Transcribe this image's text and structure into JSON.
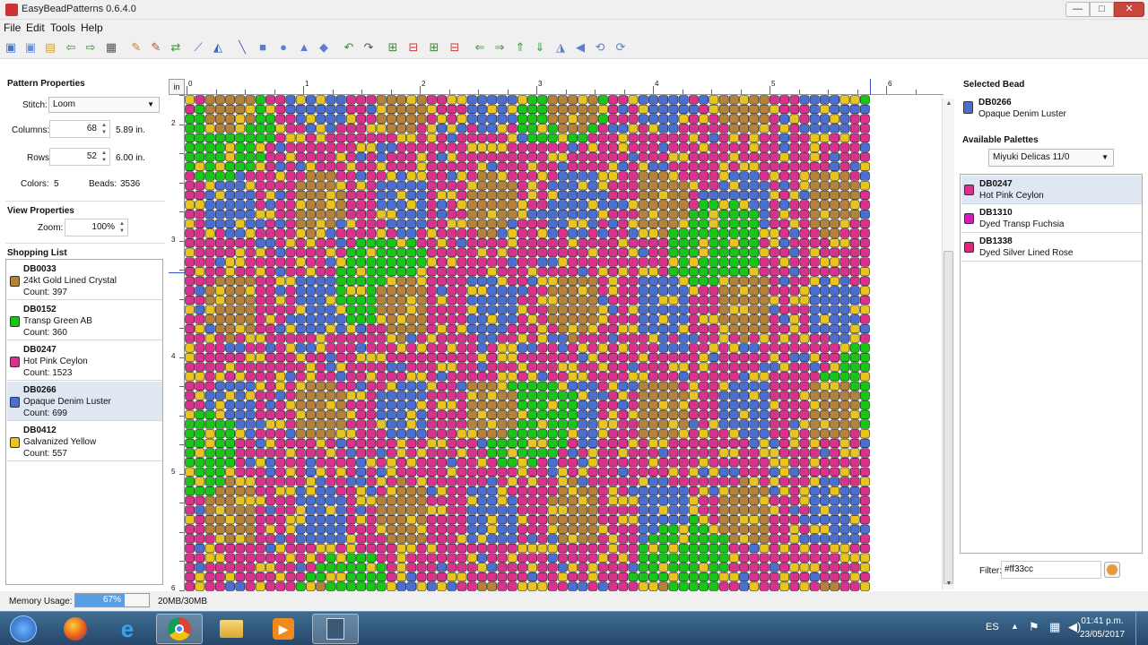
{
  "window": {
    "title": "EasyBeadPatterns 0.6.4.0",
    "min_label": "—",
    "max_label": "□",
    "close_label": "✕"
  },
  "menu": [
    "File",
    "Edit",
    "Tools",
    "Help"
  ],
  "toolbar": [
    {
      "name": "new-icon",
      "glyph": "▣",
      "color": "#4a78c8"
    },
    {
      "name": "new-image-icon",
      "glyph": "▣",
      "color": "#6a8ed8"
    },
    {
      "name": "open-icon",
      "glyph": "▤",
      "color": "#d4a63a"
    },
    {
      "name": "import-icon",
      "glyph": "⇦",
      "color": "#3a8a3a"
    },
    {
      "name": "export-icon",
      "glyph": "⇨",
      "color": "#3a8a3a"
    },
    {
      "name": "print-icon",
      "glyph": "▦",
      "color": "#555555"
    },
    {
      "name": "pencil-icon",
      "glyph": "✎",
      "color": "#d08020"
    },
    {
      "name": "pencil-alt-icon",
      "glyph": "✎",
      "color": "#c05020"
    },
    {
      "name": "replace-color-icon",
      "glyph": "⇄",
      "color": "#3a9a3a"
    },
    {
      "name": "eyedropper-icon",
      "glyph": "⟋",
      "color": "#4466bb"
    },
    {
      "name": "fill-icon",
      "glyph": "◭",
      "color": "#4466bb"
    },
    {
      "name": "line-icon",
      "glyph": "╲",
      "color": "#4466bb"
    },
    {
      "name": "rectangle-icon",
      "glyph": "■",
      "color": "#5a7ed0"
    },
    {
      "name": "circle-icon",
      "glyph": "●",
      "color": "#5a7ed0"
    },
    {
      "name": "triangle-icon",
      "glyph": "▲",
      "color": "#5a7ed0"
    },
    {
      "name": "diamond-icon",
      "glyph": "◆",
      "color": "#5a7ed0"
    },
    {
      "name": "undo-icon",
      "glyph": "↶",
      "color": "#3a8a3a"
    },
    {
      "name": "redo-icon",
      "glyph": "↷",
      "color": "#555555"
    },
    {
      "name": "insert-column-icon",
      "glyph": "⊞",
      "color": "#3a8a3a"
    },
    {
      "name": "delete-column-icon",
      "glyph": "⊟",
      "color": "#c04040"
    },
    {
      "name": "insert-row-icon",
      "glyph": "⊞",
      "color": "#3a8a3a"
    },
    {
      "name": "delete-row-icon",
      "glyph": "⊟",
      "color": "#c04040"
    },
    {
      "name": "shift-left-icon",
      "glyph": "⇐",
      "color": "#3a9a3a"
    },
    {
      "name": "shift-right-icon",
      "glyph": "⇒",
      "color": "#3a9a3a"
    },
    {
      "name": "shift-up-icon",
      "glyph": "⇑",
      "color": "#3a9a3a"
    },
    {
      "name": "shift-down-icon",
      "glyph": "⇓",
      "color": "#3a9a3a"
    },
    {
      "name": "flip-horizontal-icon",
      "glyph": "◮",
      "color": "#5a7ed0"
    },
    {
      "name": "flip-vertical-icon",
      "glyph": "◀",
      "color": "#5a7ed0"
    },
    {
      "name": "rotate-left-icon",
      "glyph": "⟲",
      "color": "#5a7ed0"
    },
    {
      "name": "rotate-right-icon",
      "glyph": "⟳",
      "color": "#5a7ed0"
    }
  ],
  "pattern_properties": {
    "title": "Pattern Properties",
    "stitch_label": "Stitch:",
    "stitch_value": "Loom",
    "columns_label": "Columns:",
    "columns_value": "68",
    "columns_in": "5.89 in.",
    "rows_label": "Rows:",
    "rows_value": "52",
    "rows_in": "6.00 in.",
    "colors_label": "Colors:",
    "colors_value": "5",
    "beads_label": "Beads:",
    "beads_value": "3536"
  },
  "view_properties": {
    "title": "View Properties",
    "zoom_label": "Zoom:",
    "zoom_value": "100%"
  },
  "shopping_list": {
    "title": "Shopping List",
    "items": [
      {
        "code": "DB0033",
        "name": "24kt Gold Lined Crystal",
        "count": "Count: 397",
        "color": "#b5823c"
      },
      {
        "code": "DB0152",
        "name": "Transp Green AB",
        "count": "Count: 360",
        "color": "#18c618"
      },
      {
        "code": "DB0247",
        "name": "Hot Pink Ceylon",
        "count": "Count: 1523",
        "color": "#d9318c"
      },
      {
        "code": "DB0266",
        "name": "Opaque Denim Luster",
        "count": "Count: 699",
        "color": "#4a6fd0"
      },
      {
        "code": "DB0412",
        "name": "Galvanized Yellow",
        "count": "Count: 557",
        "color": "#e8c423"
      }
    ],
    "selected_index": 3
  },
  "canvas": {
    "unit": "in",
    "top_ticks": [
      "0",
      "1",
      "2",
      "3",
      "4",
      "5",
      "6"
    ],
    "left_ticks": [
      "2",
      "3",
      "4",
      "5",
      "6"
    ]
  },
  "selected_bead": {
    "title": "Selected Bead",
    "code": "DB0266",
    "name": "Opaque Denim Luster",
    "color": "#4a6fd0"
  },
  "available_palettes": {
    "title": "Available Palettes",
    "selected": "Miyuki Delicas 11/0",
    "items": [
      {
        "code": "DB0247",
        "name": "Hot Pink Ceylon",
        "color": "#d9318c"
      },
      {
        "code": "DB1310",
        "name": "Dyed Transp Fuchsia",
        "color": "#d21eb4"
      },
      {
        "code": "DB1338",
        "name": "Dyed Silver Lined Rose",
        "color": "#dc2a78"
      }
    ]
  },
  "filter": {
    "label": "Filter:",
    "value": "#ff33cc"
  },
  "status": {
    "memory_label": "Memory Usage:",
    "memory_percent": 67,
    "memory_percent_text": "67%",
    "memory_text": "20MB/30MB"
  },
  "taskbar": {
    "apps": [
      "start-orb-icon",
      "firefox-icon",
      "internet-explorer-icon",
      "chrome-icon",
      "file-explorer-icon",
      "media-player-icon",
      "easybeadpatterns-icon"
    ],
    "language": "ES",
    "time": "01:41 p.m.",
    "date": "23/05/2017"
  },
  "beads": {
    "colors": [
      "#b5823c",
      "#18c618",
      "#d9318c",
      "#4a6fd0",
      "#e8c423"
    ]
  }
}
